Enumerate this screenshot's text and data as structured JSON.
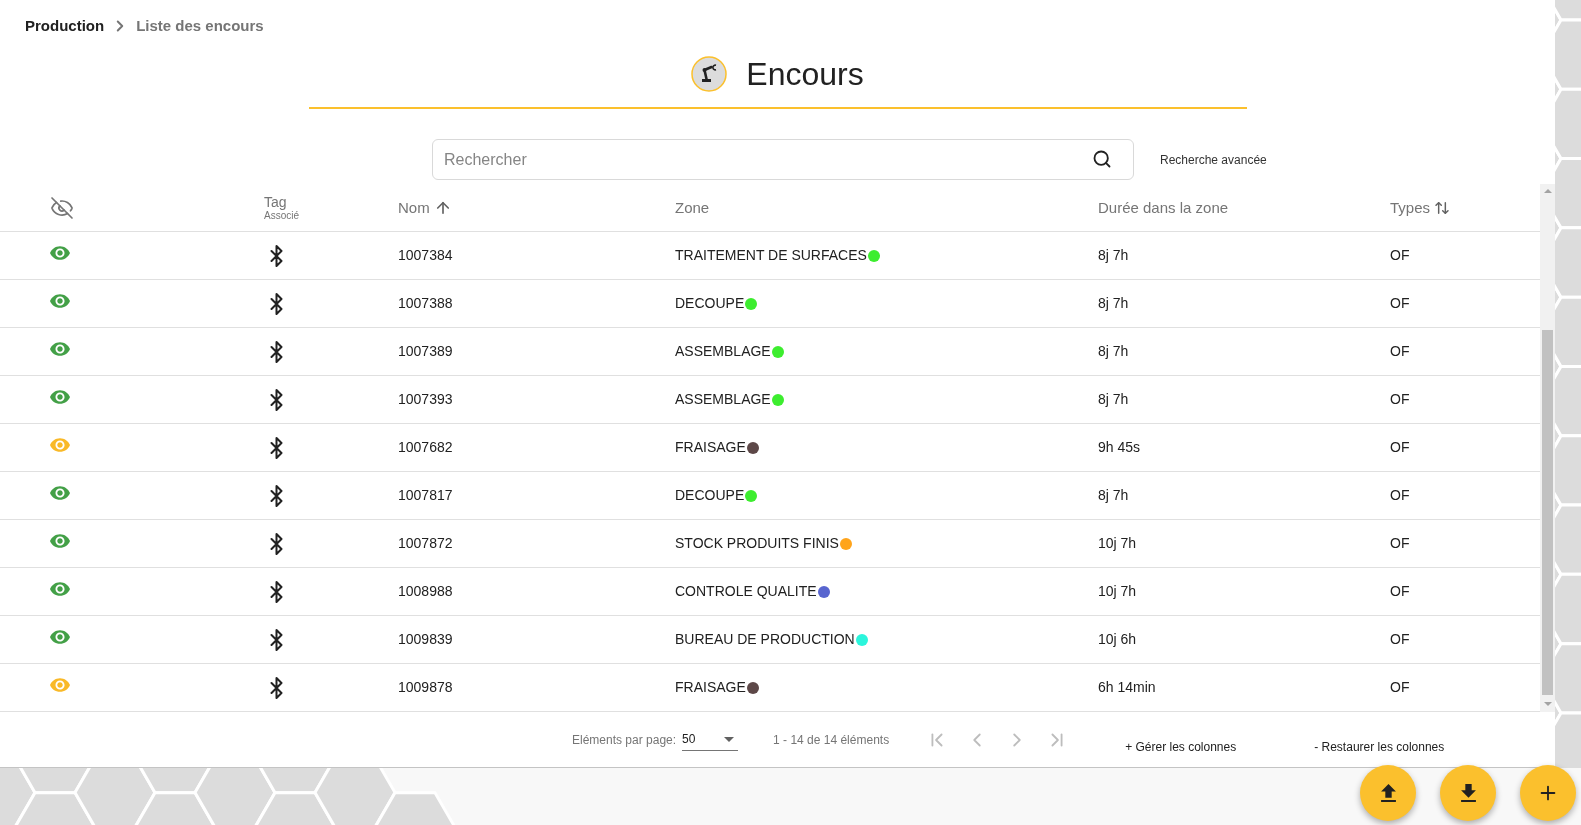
{
  "breadcrumb": [
    {
      "label": "Production",
      "current": false
    },
    {
      "label": "Liste des encours",
      "current": true
    }
  ],
  "title": "Encours",
  "search": {
    "placeholder": "Rechercher"
  },
  "advanced_search_link": "Recherche avancée",
  "table": {
    "columns": [
      {
        "kind": "icon"
      },
      {
        "kind": "stacked",
        "label": "Tag",
        "sublabel": "Associé"
      },
      {
        "kind": "sorted",
        "label": "Nom"
      },
      {
        "kind": "text",
        "label": "Zone"
      },
      {
        "kind": "text",
        "label": "Durée dans la zone"
      },
      {
        "kind": "sortable",
        "label": "Types"
      }
    ],
    "rows": [
      {
        "visibility": {
          "color": "#43a047"
        },
        "name": "1007384",
        "zone": {
          "label": "TRAITEMENT DE SURFACES",
          "color": "#3ded2f"
        },
        "duration": "8j 7h",
        "type": "OF"
      },
      {
        "visibility": {
          "color": "#43a047"
        },
        "name": "1007388",
        "zone": {
          "label": "DECOUPE",
          "color": "#3ded2f"
        },
        "duration": "8j 7h",
        "type": "OF"
      },
      {
        "visibility": {
          "color": "#43a047"
        },
        "name": "1007389",
        "zone": {
          "label": "ASSEMBLAGE",
          "color": "#3ded2f"
        },
        "duration": "8j 7h",
        "type": "OF"
      },
      {
        "visibility": {
          "color": "#43a047"
        },
        "name": "1007393",
        "zone": {
          "label": "ASSEMBLAGE",
          "color": "#3ded2f"
        },
        "duration": "8j 7h",
        "type": "OF"
      },
      {
        "visibility": {
          "color": "#f9b928"
        },
        "name": "1007682",
        "zone": {
          "label": "FRAISAGE",
          "color": "#5d4848"
        },
        "duration": "9h 45s",
        "type": "OF"
      },
      {
        "visibility": {
          "color": "#43a047"
        },
        "name": "1007817",
        "zone": {
          "label": "DECOUPE",
          "color": "#3ded2f"
        },
        "duration": "8j 7h",
        "type": "OF"
      },
      {
        "visibility": {
          "color": "#43a047"
        },
        "name": "1007872",
        "zone": {
          "label": "STOCK PRODUITS FINIS",
          "color": "#ffa41b"
        },
        "duration": "10j 7h",
        "type": "OF"
      },
      {
        "visibility": {
          "color": "#43a047"
        },
        "name": "1008988",
        "zone": {
          "label": "CONTROLE QUALITE",
          "color": "#5865cf"
        },
        "duration": "10j 7h",
        "type": "OF"
      },
      {
        "visibility": {
          "color": "#43a047"
        },
        "name": "1009839",
        "zone": {
          "label": "BUREAU DE PRODUCTION",
          "color": "#2bf5dc"
        },
        "duration": "10j 6h",
        "type": "OF"
      },
      {
        "visibility": {
          "color": "#f9b928"
        },
        "name": "1009878",
        "zone": {
          "label": "FRAISAGE",
          "color": "#5d4848"
        },
        "duration": "6h 14min",
        "type": "OF"
      }
    ]
  },
  "pagination": {
    "per_page_label": "Eléments par page:",
    "per_page": "50",
    "range": "1 - 14 de 14 éléments",
    "nav": [
      {
        "kind": "first",
        "disabled": true
      },
      {
        "kind": "previous",
        "disabled": true
      },
      {
        "kind": "next",
        "disabled": true
      },
      {
        "kind": "last",
        "disabled": true
      }
    ]
  },
  "column_actions": [
    "+ Gérer les colonnes",
    "- Restaurer les colonnes"
  ],
  "fab_buttons": [
    {
      "kind": "upload"
    },
    {
      "kind": "download"
    },
    {
      "kind": "add"
    }
  ]
}
